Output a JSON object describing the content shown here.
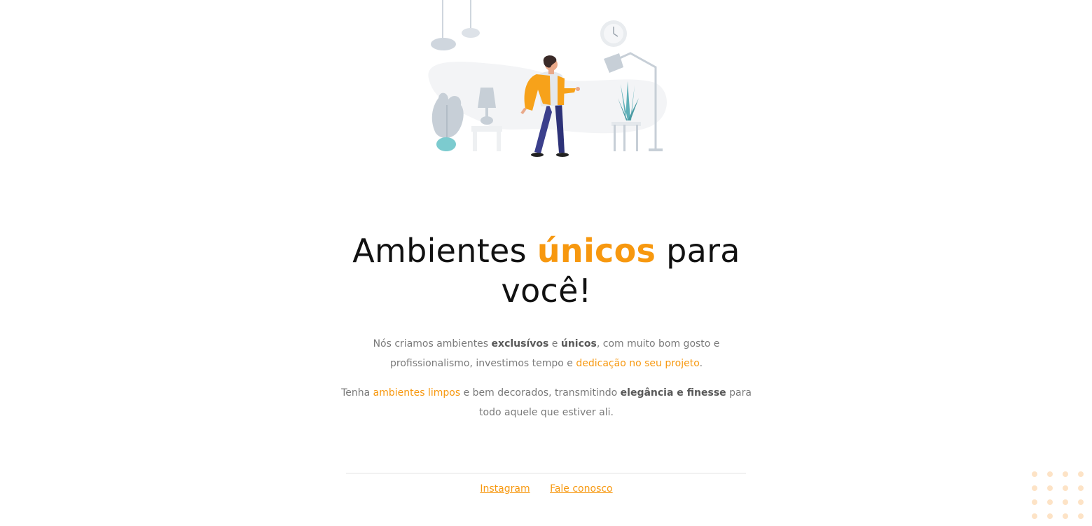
{
  "hero": {
    "title_pre": "Ambientes ",
    "title_accent": "únicos",
    "title_post": " para você!"
  },
  "paragraph1": {
    "t1": "Nós criamos ambientes ",
    "b1": "exclusívos",
    "t2": " e ",
    "b2": "únicos",
    "t3": ", com muito bom gosto e profissionalismo, investimos tempo e ",
    "hl1": "dedicação no seu projeto",
    "t4": "."
  },
  "paragraph2": {
    "t1": "Tenha ",
    "hl1": "ambientes limpos",
    "t2": " e bem decorados, transmitindo ",
    "b1": "elegância e finesse",
    "t3": " para todo aquele que estiver ali."
  },
  "footer": {
    "instagram_label": "Instagram",
    "contact_label": "Fale conosco"
  },
  "colors": {
    "accent": "#f7980f",
    "body_text": "#7a7a7a",
    "heading": "#111111",
    "divider": "#e2e2e2"
  },
  "icons": {
    "hero": "person-in-living-room-illustration",
    "decor": "dot-grid-decoration"
  }
}
